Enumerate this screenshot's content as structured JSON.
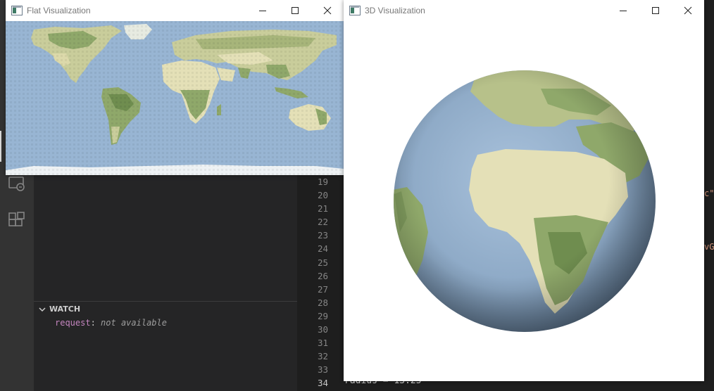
{
  "flat_window": {
    "title": "Flat Visualization"
  },
  "globe_window": {
    "title": "3D Visualization"
  },
  "window_controls": {
    "minimize_icon": "minimize-icon",
    "maximize_icon": "maximize-icon",
    "close_icon": "close-icon"
  },
  "activity_bar": {
    "icons": [
      "remote-explorer-icon",
      "extensions-icon"
    ]
  },
  "debug_watch": {
    "header": "WATCH",
    "items": [
      {
        "name": "request",
        "separator": ":",
        "value": "not available"
      }
    ]
  },
  "editor": {
    "line_numbers": [
      "19",
      "20",
      "21",
      "22",
      "23",
      "24",
      "25",
      "26",
      "27",
      "28",
      "29",
      "30",
      "31",
      "32",
      "33",
      "34"
    ],
    "current_line": "34",
    "visible_code": "radius = 13.25",
    "fragments": [
      "c\"",
      "vG"
    ]
  },
  "colors": {
    "ocean": "#98b5d3",
    "land_green": "#8fa86a",
    "land_dark_green": "#6f8d4f",
    "desert": "#e4e0b7",
    "ice": "#eef2f4",
    "watch_name": "#c586c0"
  }
}
